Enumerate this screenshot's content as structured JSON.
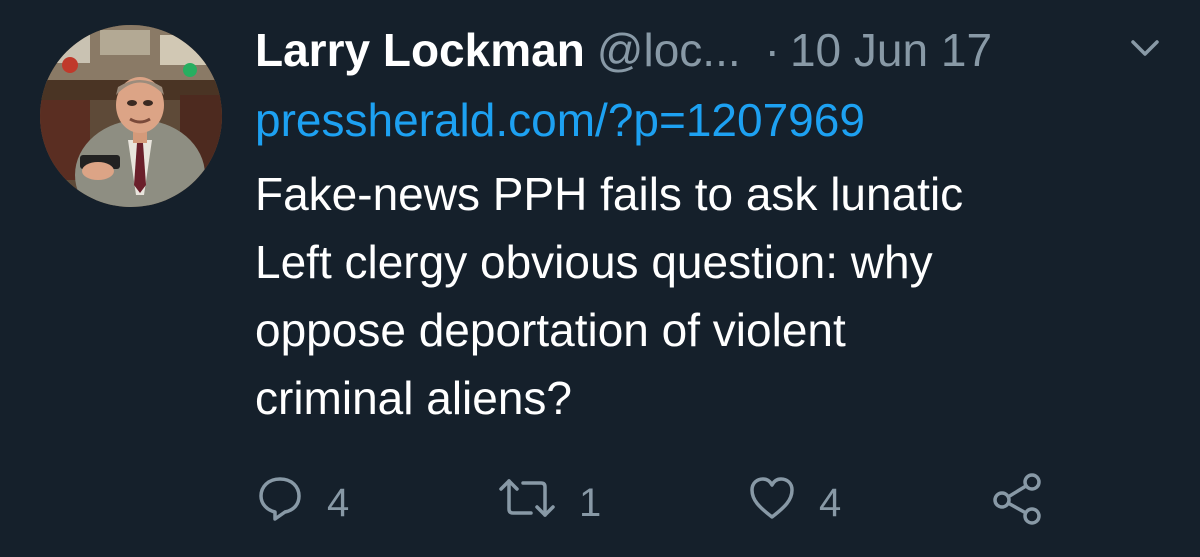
{
  "tweet": {
    "display_name": "Larry Lockman",
    "handle": "@loc...",
    "separator": "·",
    "date": "10 Jun 17",
    "link": "pressherald.com/?p=1207969",
    "text_lines": [
      "Fake-news PPH fails to ask lunatic",
      "Left clergy obvious question: why",
      "oppose deportation of violent",
      "criminal aliens?"
    ]
  },
  "actions": {
    "reply": {
      "icon": "reply-icon",
      "count": "4"
    },
    "retweet": {
      "icon": "retweet-icon",
      "count": "1"
    },
    "like": {
      "icon": "heart-icon",
      "count": "4"
    },
    "share": {
      "icon": "share-icon"
    }
  },
  "colors": {
    "background": "#15202b",
    "primary_text": "#ffffff",
    "secondary_text": "#8899a6",
    "link": "#1da1f2"
  }
}
